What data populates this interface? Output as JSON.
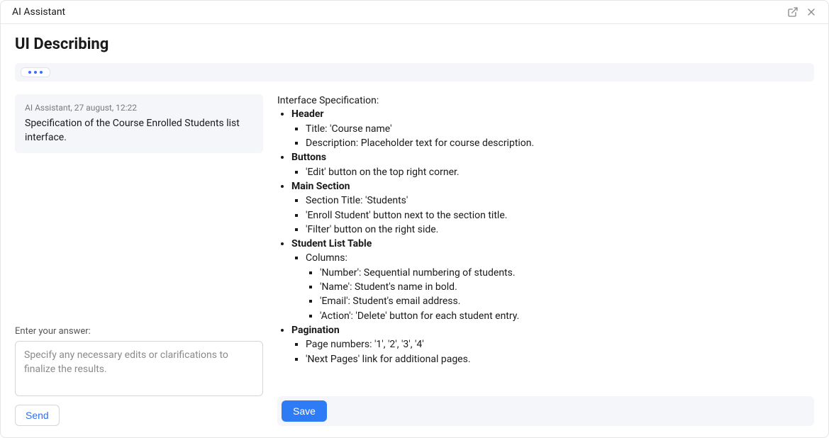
{
  "titlebar": {
    "title": "AI Assistant"
  },
  "heading": "UI Describing",
  "message": {
    "meta": "AI Assistant, 27 august, 12:22",
    "body": "Specification of the Course Enrolled Students list interface."
  },
  "answer": {
    "label": "Enter your answer:",
    "placeholder": "Specify any necessary edits or clarifications to finalize the results."
  },
  "send_label": "Send",
  "save_label": "Save",
  "spec": {
    "lead": "Interface Specification:",
    "sections": [
      {
        "title": "Header",
        "items": [
          "Title: 'Course name'",
          "Description: Placeholder text for course description."
        ]
      },
      {
        "title": "Buttons",
        "items": [
          "'Edit' button on the top right corner."
        ]
      },
      {
        "title": "Main Section",
        "items": [
          "Section Title: 'Students'",
          "'Enroll Student' button next to the section title.",
          "'Filter' button on the right side."
        ]
      },
      {
        "title": "Student List Table",
        "items": [
          "Columns:"
        ],
        "subitems": [
          "'Number': Sequential numbering of students.",
          "'Name': Student's name in bold.",
          "'Email': Student's email address.",
          "'Action': 'Delete' button for each student entry."
        ]
      },
      {
        "title": "Pagination",
        "items": [
          "Page numbers: '1', '2', '3', '4'",
          "'Next Pages' link for additional pages."
        ]
      }
    ]
  }
}
